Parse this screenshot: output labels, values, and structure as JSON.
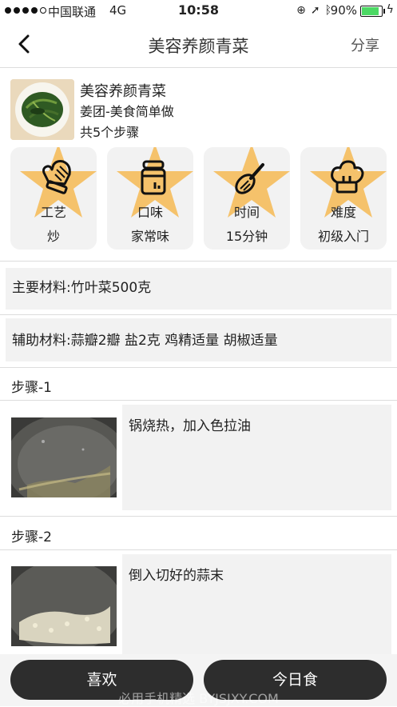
{
  "status_bar": {
    "carrier": "中国联通",
    "network": "4G",
    "time": "10:58",
    "battery": "90%",
    "battery_level": 0.9,
    "signal_bars": 4,
    "icons": [
      "lock-rotation-icon",
      "location-arrow-icon",
      "bluetooth-icon",
      "charging-bolt-icon"
    ]
  },
  "nav": {
    "title": "美容养颜青菜",
    "share": "分享",
    "back_icon": "chevron-left-icon"
  },
  "recipe": {
    "name": "美容养颜青菜",
    "author": "姜团-美食简单做",
    "steps_count": "共5个步骤"
  },
  "info_cards": [
    {
      "label": "工艺",
      "value": "炒",
      "icon": "oven-mitt-icon"
    },
    {
      "label": "口味",
      "value": "家常味",
      "icon": "spice-jar-icon"
    },
    {
      "label": "时间",
      "value": "15分钟",
      "icon": "whisk-icon"
    },
    {
      "label": "难度",
      "value": "初级入门",
      "icon": "chef-hat-icon"
    }
  ],
  "colors": {
    "accent": "#f5c26b",
    "dark": "#2d2d2d",
    "panel": "#f2f2f2"
  },
  "materials": {
    "main": "主要材料:竹叶菜500克",
    "aux": "辅助材料:蒜瓣2瓣 盐2克 鸡精适量 胡椒适量"
  },
  "steps": [
    {
      "title": "步骤-1",
      "text": "锅烧热，加入色拉油"
    },
    {
      "title": "步骤-2",
      "text": "倒入切好的蒜末"
    }
  ],
  "bottom": {
    "like": "喜欢",
    "today": "今日食",
    "watermark": "必用手机精选 BYJSJXY.COM"
  }
}
